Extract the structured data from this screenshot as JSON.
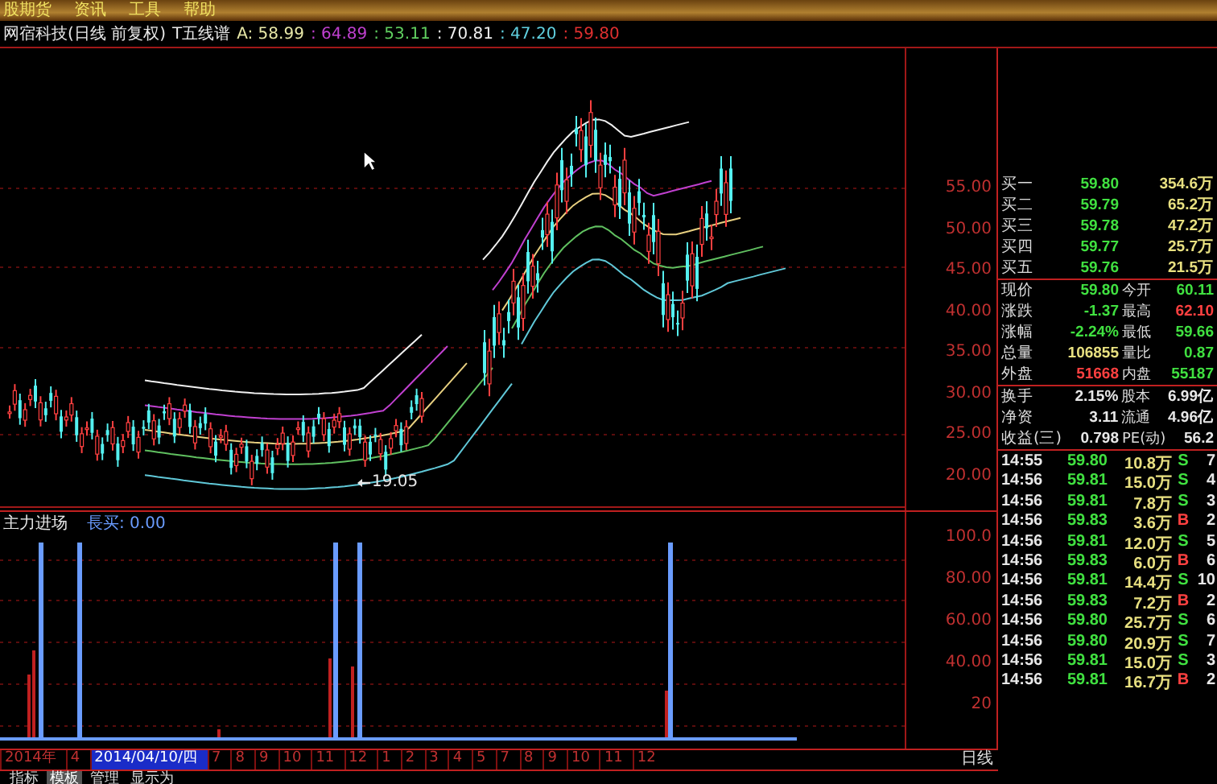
{
  "menu": [
    "股期货",
    "资讯",
    "工具",
    "帮助"
  ],
  "title": {
    "stock": "网宿科技(日线 前复权)",
    "indicator": "T五线谱",
    "values": [
      {
        "text": "A: 58.99",
        "color": "#e8e8a8"
      },
      {
        "text": ": 64.89",
        "color": "#c040d0"
      },
      {
        "text": ": 53.11",
        "color": "#60d060"
      },
      {
        "text": ": 70.81",
        "color": "#f0f0f0"
      },
      {
        "text": ": 47.20",
        "color": "#60d0e0"
      },
      {
        "text": ": 59.80",
        "color": "#e03030"
      }
    ]
  },
  "price_axis": [
    "55.00",
    "50.00",
    "45.00",
    "40.00",
    "35.00",
    "30.00",
    "25.00",
    "20.00"
  ],
  "low_marker": "19.05",
  "indicator": {
    "name": "主力进场",
    "reading": "長买: 0.00",
    "axis": [
      "100.0",
      "80.00",
      "60.00",
      "40.00",
      "20"
    ]
  },
  "date_axis": [
    {
      "label": "2014年",
      "selected": false
    },
    {
      "label": "4",
      "selected": false
    },
    {
      "label": "2014/04/10/四",
      "selected": true
    },
    {
      "label": "7",
      "selected": false
    },
    {
      "label": "8",
      "selected": false
    },
    {
      "label": "9",
      "selected": false
    },
    {
      "label": "10",
      "selected": false
    },
    {
      "label": "11",
      "selected": false
    },
    {
      "label": "12",
      "selected": false
    },
    {
      "label": "1",
      "selected": false
    },
    {
      "label": "2",
      "selected": false
    },
    {
      "label": "3",
      "selected": false
    },
    {
      "label": "4",
      "selected": false
    },
    {
      "label": "5",
      "selected": false
    },
    {
      "label": "7",
      "selected": false
    },
    {
      "label": "8",
      "selected": false
    },
    {
      "label": "9",
      "selected": false
    },
    {
      "label": "10",
      "selected": false
    },
    {
      "label": "11",
      "selected": false
    },
    {
      "label": "12",
      "selected": false
    }
  ],
  "period": "日线",
  "bottom_tabs": [
    {
      "label": "指标",
      "selected": false
    },
    {
      "label": "模板",
      "selected": true
    },
    {
      "label": "管理",
      "selected": false
    },
    {
      "label": "显示为",
      "selected": false
    }
  ],
  "order_book": [
    {
      "label": "买一",
      "price": "59.80",
      "volume": "354.6万"
    },
    {
      "label": "买二",
      "price": "59.79",
      "volume": "65.2万"
    },
    {
      "label": "买三",
      "price": "59.78",
      "volume": "47.2万"
    },
    {
      "label": "买四",
      "price": "59.77",
      "volume": "25.7万"
    },
    {
      "label": "买五",
      "price": "59.76",
      "volume": "21.5万"
    }
  ],
  "quote": [
    {
      "cells": [
        {
          "label": "现价",
          "value": "59.80",
          "color": "#40e040"
        },
        {
          "label": "今开",
          "value": "60.11",
          "color": "#40e040"
        }
      ]
    },
    {
      "cells": [
        {
          "label": "涨跌",
          "value": "-1.37",
          "color": "#40e040"
        },
        {
          "label": "最高",
          "value": "62.10",
          "color": "#ff4040"
        }
      ]
    },
    {
      "cells": [
        {
          "label": "涨幅",
          "value": "-2.24%",
          "color": "#40e040"
        },
        {
          "label": "最低",
          "value": "59.66",
          "color": "#40e040"
        }
      ]
    },
    {
      "cells": [
        {
          "label": "总量",
          "value": "106855",
          "color": "#e8e080"
        },
        {
          "label": "量比",
          "value": "0.87",
          "color": "#40e040"
        }
      ]
    },
    {
      "cells": [
        {
          "label": "外盘",
          "value": "51668",
          "color": "#ff4040"
        },
        {
          "label": "内盘",
          "value": "55187",
          "color": "#40e040"
        }
      ]
    },
    {
      "cells": [
        {
          "label": "换手",
          "value": "2.15%",
          "color": "#e8e8e8"
        },
        {
          "label": "股本",
          "value": "6.99亿",
          "color": "#e8e8e8"
        }
      ]
    },
    {
      "cells": [
        {
          "label": "净资",
          "value": "3.11",
          "color": "#e8e8e8"
        },
        {
          "label": "流通",
          "value": "4.96亿",
          "color": "#e8e8e8"
        }
      ]
    },
    {
      "cells": [
        {
          "label": "收益(三)",
          "value": "0.798",
          "color": "#e8e8e8"
        },
        {
          "label": "PE(动)",
          "value": "56.2",
          "color": "#e8e8e8"
        }
      ]
    }
  ],
  "trades": [
    {
      "time": "14:55",
      "price": "59.80",
      "volume": "10.8万",
      "side": "S",
      "count": "7"
    },
    {
      "time": "14:56",
      "price": "59.81",
      "volume": "15.0万",
      "side": "S",
      "count": "4"
    },
    {
      "time": "14:56",
      "price": "59.81",
      "volume": "7.8万",
      "side": "S",
      "count": "3"
    },
    {
      "time": "14:56",
      "price": "59.83",
      "volume": "3.6万",
      "side": "B",
      "count": "2"
    },
    {
      "time": "14:56",
      "price": "59.81",
      "volume": "12.0万",
      "side": "S",
      "count": "5"
    },
    {
      "time": "14:56",
      "price": "59.83",
      "volume": "6.0万",
      "side": "B",
      "count": "6"
    },
    {
      "time": "14:56",
      "price": "59.81",
      "volume": "14.4万",
      "side": "S",
      "count": "10"
    },
    {
      "time": "14:56",
      "price": "59.83",
      "volume": "7.2万",
      "side": "B",
      "count": "2"
    },
    {
      "time": "14:56",
      "price": "59.80",
      "volume": "25.7万",
      "side": "S",
      "count": "6"
    },
    {
      "time": "14:56",
      "price": "59.80",
      "volume": "20.9万",
      "side": "S",
      "count": "7"
    },
    {
      "time": "14:56",
      "price": "59.81",
      "volume": "15.0万",
      "side": "S",
      "count": "3"
    },
    {
      "time": "14:56",
      "price": "59.81",
      "volume": "16.7万",
      "side": "B",
      "count": "2"
    }
  ]
}
